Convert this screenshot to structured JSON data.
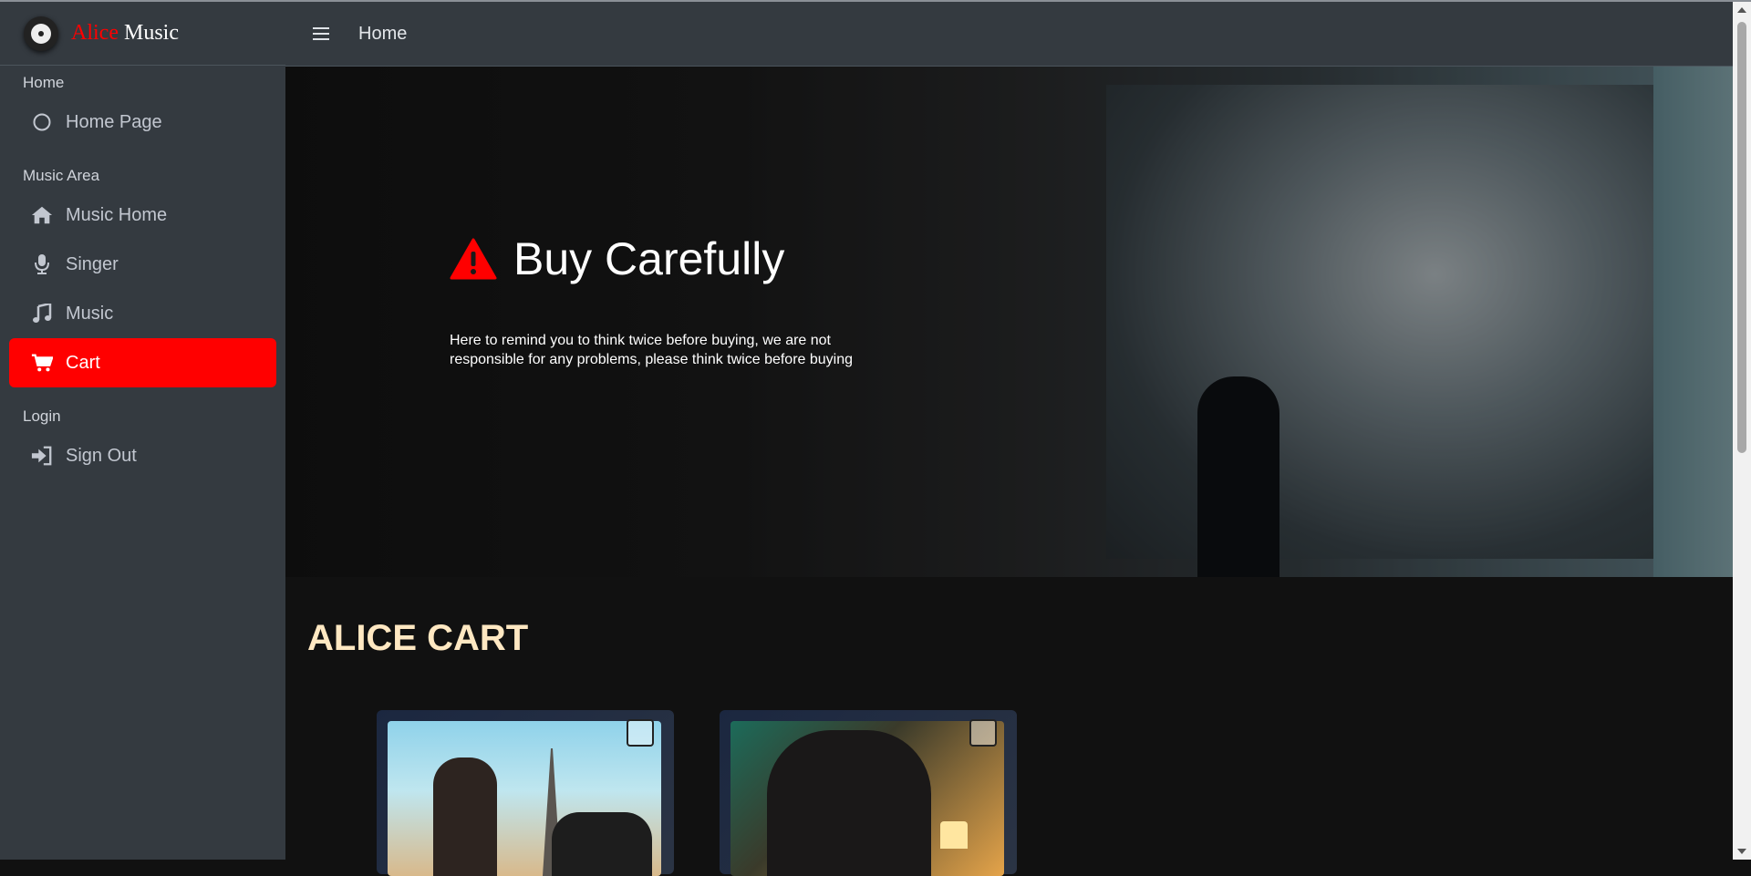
{
  "brand": {
    "name_part1": "Alice",
    "name_part2": "Music"
  },
  "topbar": {
    "title": "Home"
  },
  "sidebar": {
    "sections": [
      {
        "header": "Home",
        "items": [
          {
            "label": "Home Page",
            "icon": "circle-icon"
          }
        ]
      },
      {
        "header": "Music Area",
        "items": [
          {
            "label": "Music Home",
            "icon": "house-icon"
          },
          {
            "label": "Singer",
            "icon": "microphone-icon"
          },
          {
            "label": "Music",
            "icon": "music-note-icon"
          },
          {
            "label": "Cart",
            "icon": "cart-icon",
            "active": true
          }
        ]
      },
      {
        "header": "Login",
        "items": [
          {
            "label": "Sign Out",
            "icon": "sign-out-icon"
          }
        ]
      }
    ]
  },
  "hero": {
    "title": "Buy Carefully",
    "icon": "warning-icon",
    "text": "Here to remind you to think twice before buying, we are not responsible for any problems, please think twice before buying"
  },
  "cart": {
    "title": "ALICE CART"
  },
  "colors": {
    "accent": "#ff0000",
    "sidebar_bg": "#343a40",
    "page_bg": "#111111",
    "cart_title": "#ffe8c2"
  }
}
